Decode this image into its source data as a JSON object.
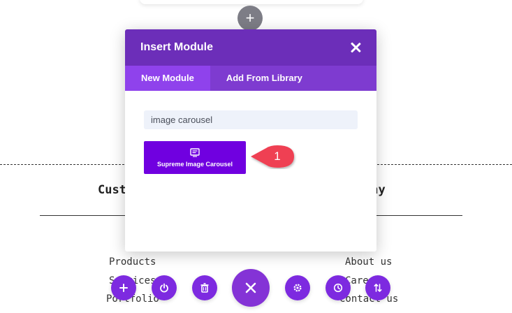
{
  "background": {
    "heading_left": "Cust",
    "heading_right": "any",
    "links_left": [
      "Products",
      "Services",
      "Portfolio"
    ],
    "links_right": [
      "About us",
      "Careers",
      "Contact us"
    ]
  },
  "modal": {
    "title": "Insert Module",
    "tabs": [
      {
        "label": "New Module",
        "active": true
      },
      {
        "label": "Add From Library",
        "active": false
      }
    ],
    "search_value": "image carousel",
    "result_module": {
      "label": "Supreme Image Carousel",
      "icon": "module-icon"
    }
  },
  "callout": {
    "number": "1"
  },
  "toolbar": {
    "buttons": [
      "add-icon",
      "power-icon",
      "trash-icon",
      "close-icon",
      "gear-icon",
      "history-icon",
      "sort-icon"
    ]
  },
  "colors": {
    "header": "#6c2eb9",
    "tabs_bar": "#7e3bd0",
    "active_tab": "#8f42ec",
    "module_button": "#7000e0",
    "toolbar_button": "#7d2ae0",
    "callout": "#ef3f52"
  }
}
